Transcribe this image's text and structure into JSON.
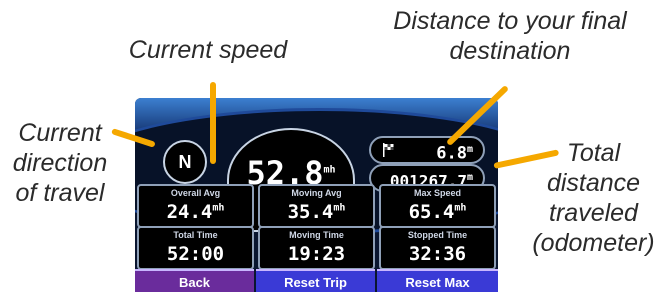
{
  "callouts": {
    "speed": "Current speed",
    "destination_line1": "Distance to your final",
    "destination_line2": "destination",
    "direction_line1": "Current",
    "direction_line2": "direction",
    "direction_line3": "of travel",
    "odometer_line1": "Total",
    "odometer_line2": "distance",
    "odometer_line3": "traveled",
    "odometer_line4": "(odometer)"
  },
  "device": {
    "direction": "N",
    "speed": "52.8",
    "speed_unit": "mh",
    "dest_distance": "6.8",
    "dest_unit": "m",
    "odometer": "001267.7",
    "odometer_unit": "m",
    "cells": [
      {
        "label": "Overall Avg",
        "value": "24.4",
        "unit": "mh"
      },
      {
        "label": "Moving Avg",
        "value": "35.4",
        "unit": "mh"
      },
      {
        "label": "Max Speed",
        "value": "65.4",
        "unit": "mh"
      },
      {
        "label": "Total Time",
        "value": "52:00"
      },
      {
        "label": "Moving Time",
        "value": "19:23"
      },
      {
        "label": "Stopped Time",
        "value": "32:36"
      }
    ],
    "buttons": {
      "back": "Back",
      "reset_trip": "Reset Trip",
      "reset_max": "Reset Max"
    }
  },
  "colors": {
    "callout_line": "#f5a800",
    "button_blue": "#3a3ad6",
    "button_purple": "#6a2c9c"
  }
}
